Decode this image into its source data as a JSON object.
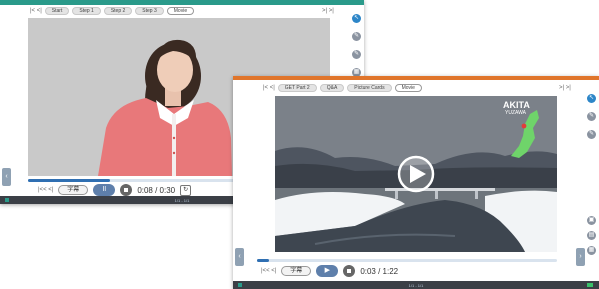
{
  "window1": {
    "tabs": [
      "Start",
      "Step 1",
      "Step 2",
      "Step 3",
      "Movie"
    ],
    "nav_prev": "|< <|",
    "nav_next": ">| >|",
    "controls": {
      "skip_back": "|<< <|",
      "subtitle_label": "字幕",
      "play_state_label": "II",
      "time": "0:08 / 0:30",
      "progress": 0.27
    },
    "status": "1/1 - 1/1"
  },
  "window2": {
    "tabs": [
      "GET Part 2",
      "Q&A",
      "Picture Cards",
      "Movie"
    ],
    "nav_prev": "|< <|",
    "nav_next": ">| >|",
    "overlay": {
      "place": "AKITA",
      "place_sub": "YUZAWA"
    },
    "controls": {
      "skip_back": "|<< <|",
      "subtitle_label": "字幕",
      "play_state_label": "▶",
      "time": "0:03 / 1:22",
      "progress": 0.04
    },
    "status": "1/1 - 1/1"
  },
  "colors": {
    "accent_teal": "#2a9a8a",
    "accent_orange": "#e0752b",
    "play_button": "#5e7fab",
    "progress_fill": "#2f6fb2"
  }
}
